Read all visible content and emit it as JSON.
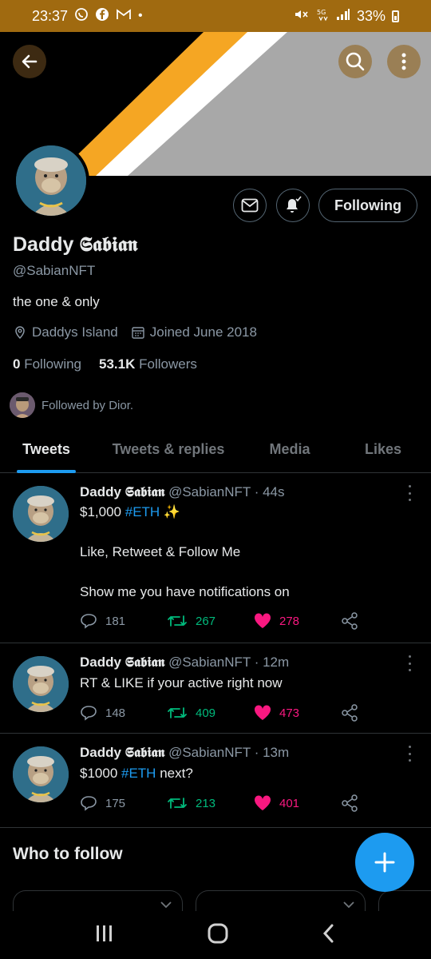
{
  "status_bar": {
    "time": "23:37",
    "battery": "33%",
    "network": "5G"
  },
  "profile": {
    "name": "Daddy 𝕾𝖆𝖇𝖎𝖆𝖓",
    "handle": "@SabianNFT",
    "bio": "the one & only",
    "location": "Daddys Island",
    "joined": "Joined June 2018",
    "following_count": "0",
    "following_label": "Following",
    "followers_count": "53.1K",
    "followers_label": "Followers",
    "followed_by": "Followed by Dior.",
    "follow_button": "Following"
  },
  "tabs": [
    {
      "label": "Tweets",
      "active": true
    },
    {
      "label": "Tweets & replies",
      "active": false
    },
    {
      "label": "Media",
      "active": false
    },
    {
      "label": "Likes",
      "active": false
    }
  ],
  "tweets": [
    {
      "name": "Daddy 𝕾𝖆𝖇𝖎𝖆𝖓",
      "handle": "@SabianNFT · 44s",
      "text_prefix": "$1,000 ",
      "hashtag": "#ETH",
      "text_suffix": " ✨",
      "line2": "Like, Retweet & Follow Me",
      "line3": "Show me you have notifications on",
      "replies": "181",
      "retweets": "267",
      "likes": "278"
    },
    {
      "name": "Daddy 𝕾𝖆𝖇𝖎𝖆𝖓",
      "handle": "@SabianNFT · 12m",
      "text": "RT & LIKE if your active right now",
      "replies": "148",
      "retweets": "409",
      "likes": "473"
    },
    {
      "name": "Daddy 𝕾𝖆𝖇𝖎𝖆𝖓",
      "handle": "@SabianNFT · 13m",
      "text_prefix": "$1000 ",
      "hashtag": "#ETH",
      "text_suffix": " next?",
      "replies": "175",
      "retweets": "213",
      "likes": "401"
    }
  ],
  "who_to_follow": {
    "title": "Who to follow"
  },
  "colors": {
    "accent": "#1d9bf0",
    "retweet": "#00ba7c",
    "like": "#f91880",
    "status_bar": "#a06a10",
    "banner_orange": "#f5a623",
    "banner_gray": "#a8a8a8"
  },
  "icons": [
    "back-arrow-icon",
    "search-icon",
    "more-vertical-icon",
    "mail-icon",
    "bell-icon",
    "location-icon",
    "calendar-icon",
    "reply-icon",
    "retweet-icon",
    "heart-icon",
    "share-icon",
    "plus-icon"
  ]
}
